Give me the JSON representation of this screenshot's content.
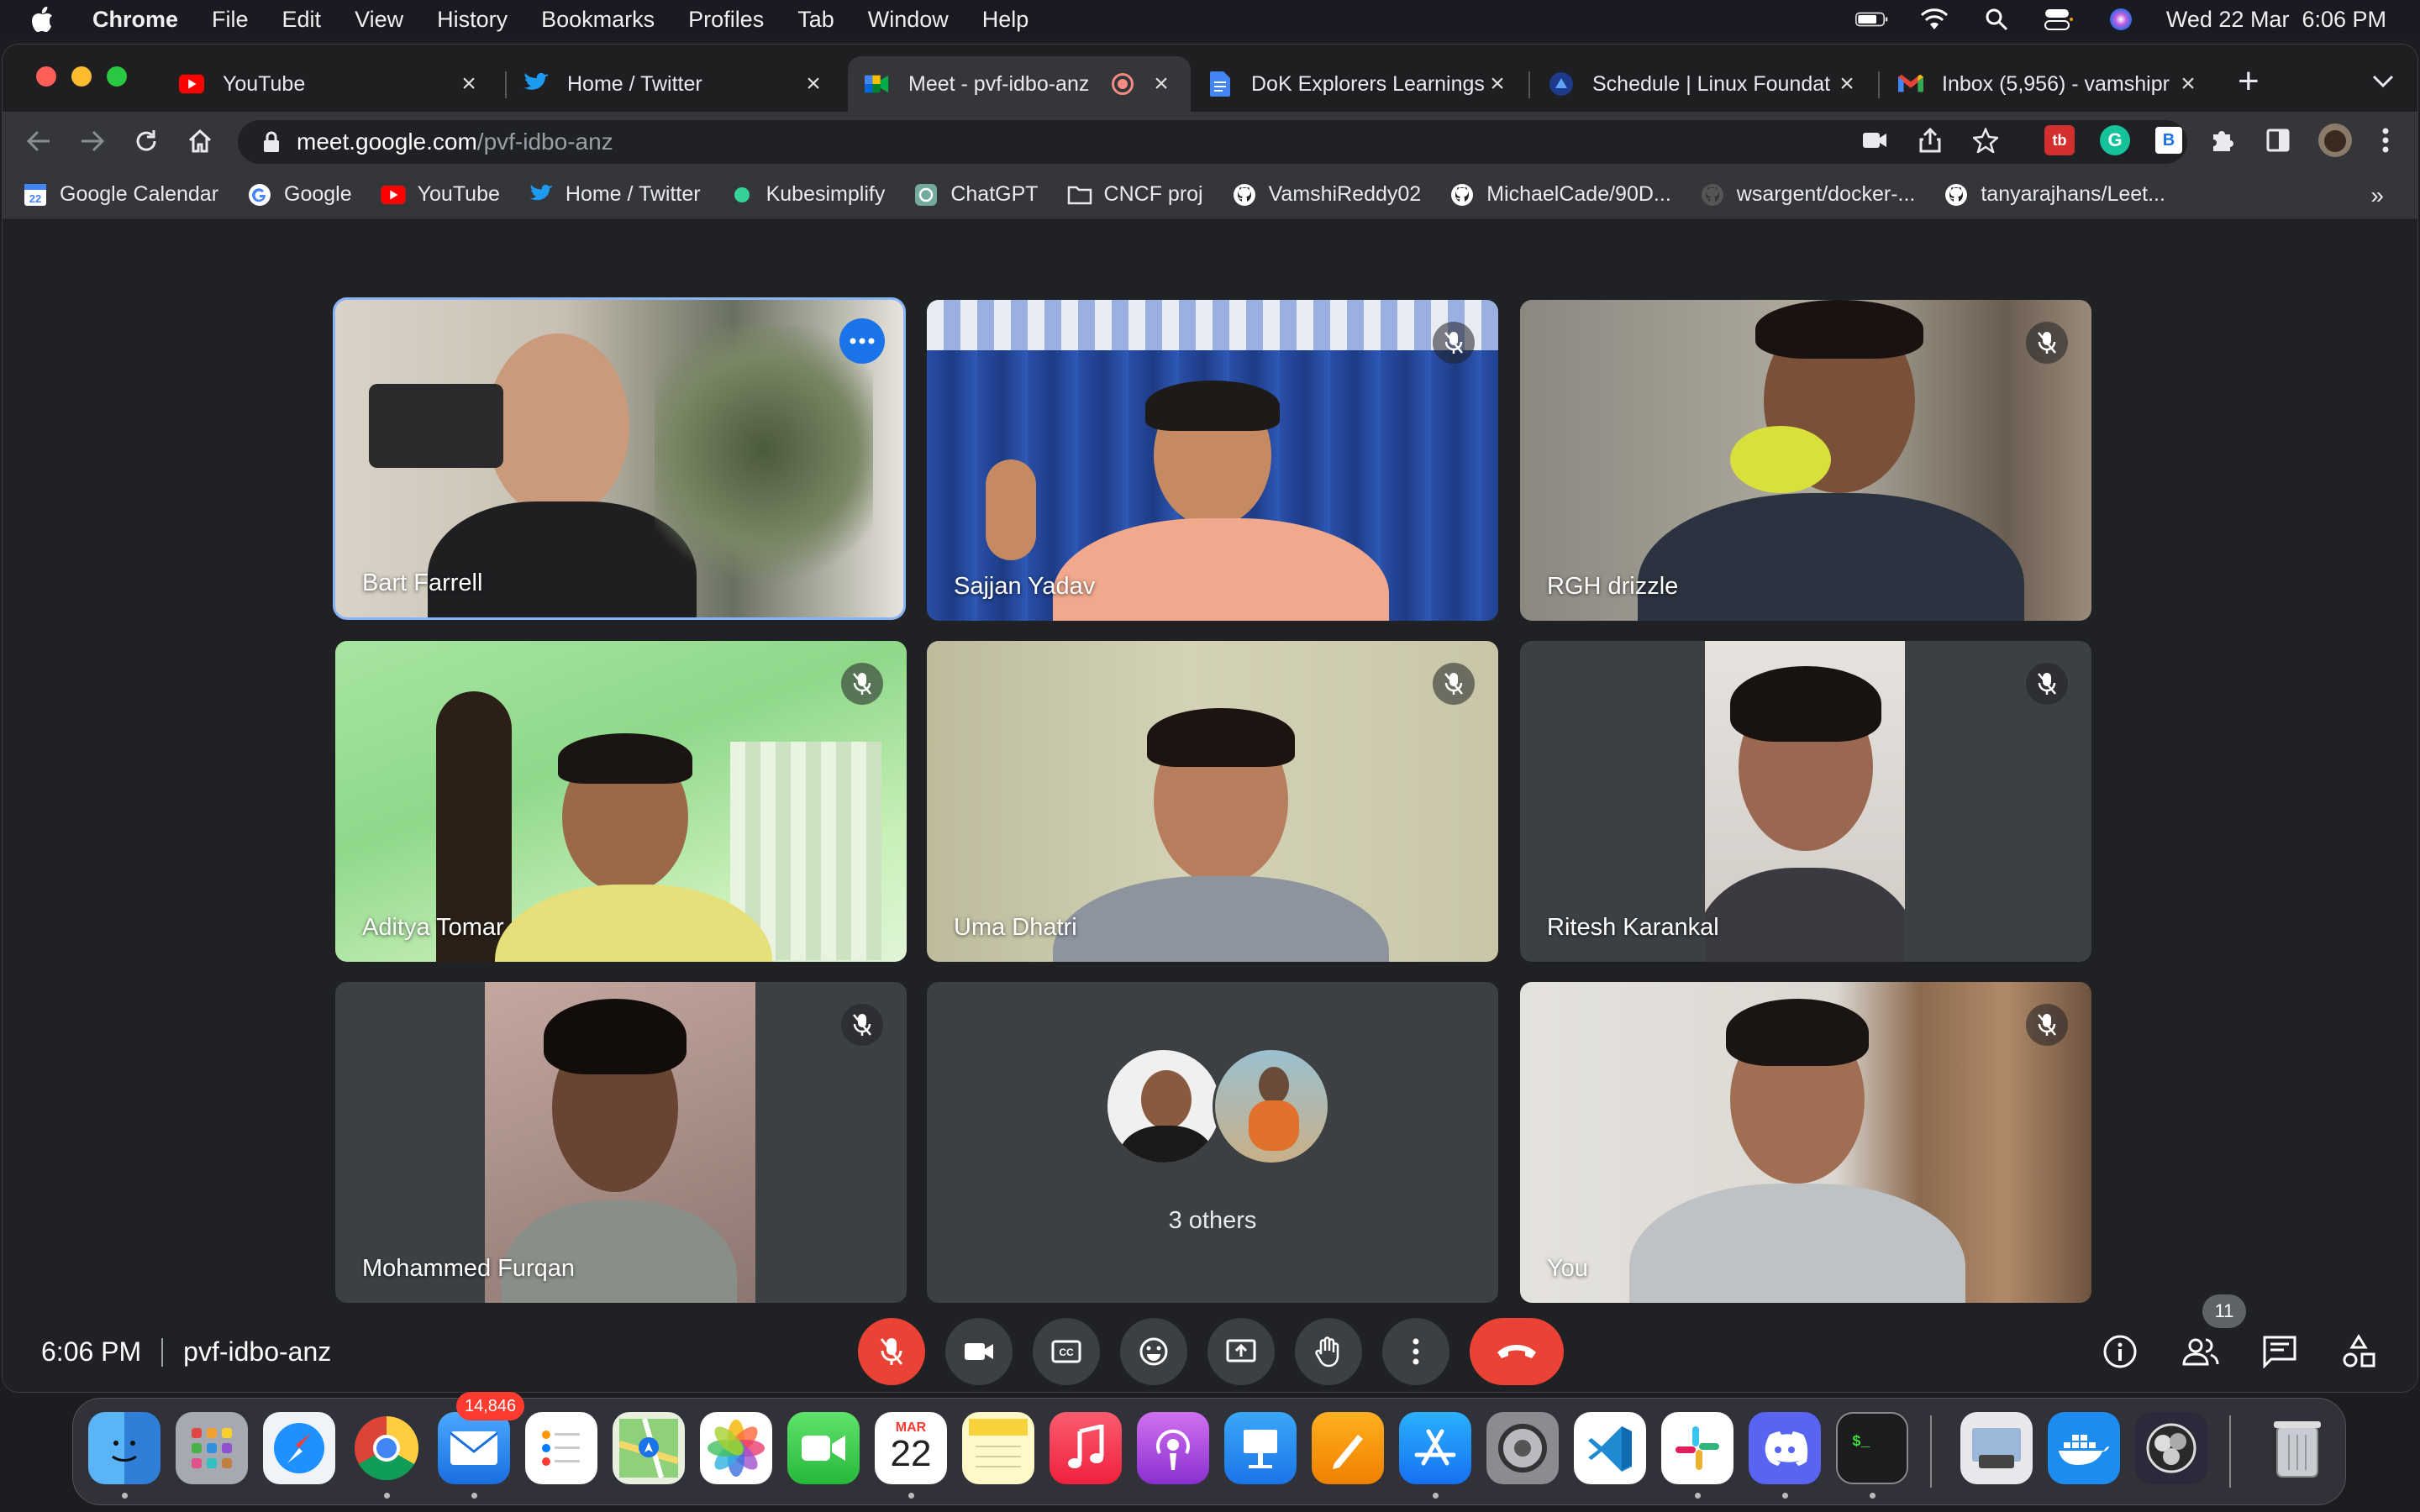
{
  "menubar": {
    "app": "Chrome",
    "items": [
      "File",
      "Edit",
      "View",
      "History",
      "Bookmarks",
      "Profiles",
      "Tab",
      "Window",
      "Help"
    ],
    "datetime": "Wed 22 Mar  6:06 PM"
  },
  "tabs": [
    {
      "title": "YouTube",
      "icon": "youtube-icon"
    },
    {
      "title": "Home / Twitter",
      "icon": "twitter-icon"
    },
    {
      "title": "Meet - pvf-idbo-anz",
      "icon": "google-meet-icon",
      "active": true
    },
    {
      "title": "DoK Explorers Learnings",
      "icon": "google-docs-icon"
    },
    {
      "title": "Schedule | Linux Foundat",
      "icon": "linux-foundation-icon"
    },
    {
      "title": "Inbox (5,956) - vamshipr",
      "icon": "gmail-icon"
    }
  ],
  "address": {
    "host": "meet.google.com",
    "path": "/pvf-idbo-anz"
  },
  "bookmarks": [
    {
      "label": "Google Calendar",
      "icon": "google-calendar-icon"
    },
    {
      "label": "Google",
      "icon": "google-icon"
    },
    {
      "label": "YouTube",
      "icon": "youtube-icon"
    },
    {
      "label": "Home / Twitter",
      "icon": "twitter-icon"
    },
    {
      "label": "Kubesimplify",
      "icon": "kubesimplify-icon"
    },
    {
      "label": "ChatGPT",
      "icon": "chatgpt-icon"
    },
    {
      "label": "CNCF proj",
      "icon": "folder-icon"
    },
    {
      "label": "VamshiReddy02",
      "icon": "github-icon"
    },
    {
      "label": "MichaelCade/90D...",
      "icon": "github-icon"
    },
    {
      "label": "wsargent/docker-...",
      "icon": "github-icon"
    },
    {
      "label": "tanyarajhans/Leet...",
      "icon": "github-icon"
    }
  ],
  "bookmarks_more": "»",
  "participants": [
    {
      "name": "Bart Farrell",
      "muted": false
    },
    {
      "name": "Sajjan Yadav",
      "muted": true
    },
    {
      "name": "RGH drizzle",
      "muted": true
    },
    {
      "name": "Aditya Tomar",
      "muted": true
    },
    {
      "name": "Uma Dhatri",
      "muted": true
    },
    {
      "name": "Ritesh Karankal",
      "muted": true
    },
    {
      "name": "Mohammed Furqan",
      "muted": true
    },
    {
      "name": "3 others",
      "muted": false
    },
    {
      "name": "You",
      "muted": true
    }
  ],
  "meeting": {
    "time": "6:06 PM",
    "code": "pvf-idbo-anz",
    "participant_count": "11"
  },
  "dock": {
    "mail_badge": "14,846",
    "calendar_month": "MAR",
    "calendar_day": "22"
  },
  "colors": {
    "accent": "#8ab4f8",
    "end_call": "#ea4335",
    "meet_bg": "#202124",
    "tile_bg": "#3c4043"
  }
}
